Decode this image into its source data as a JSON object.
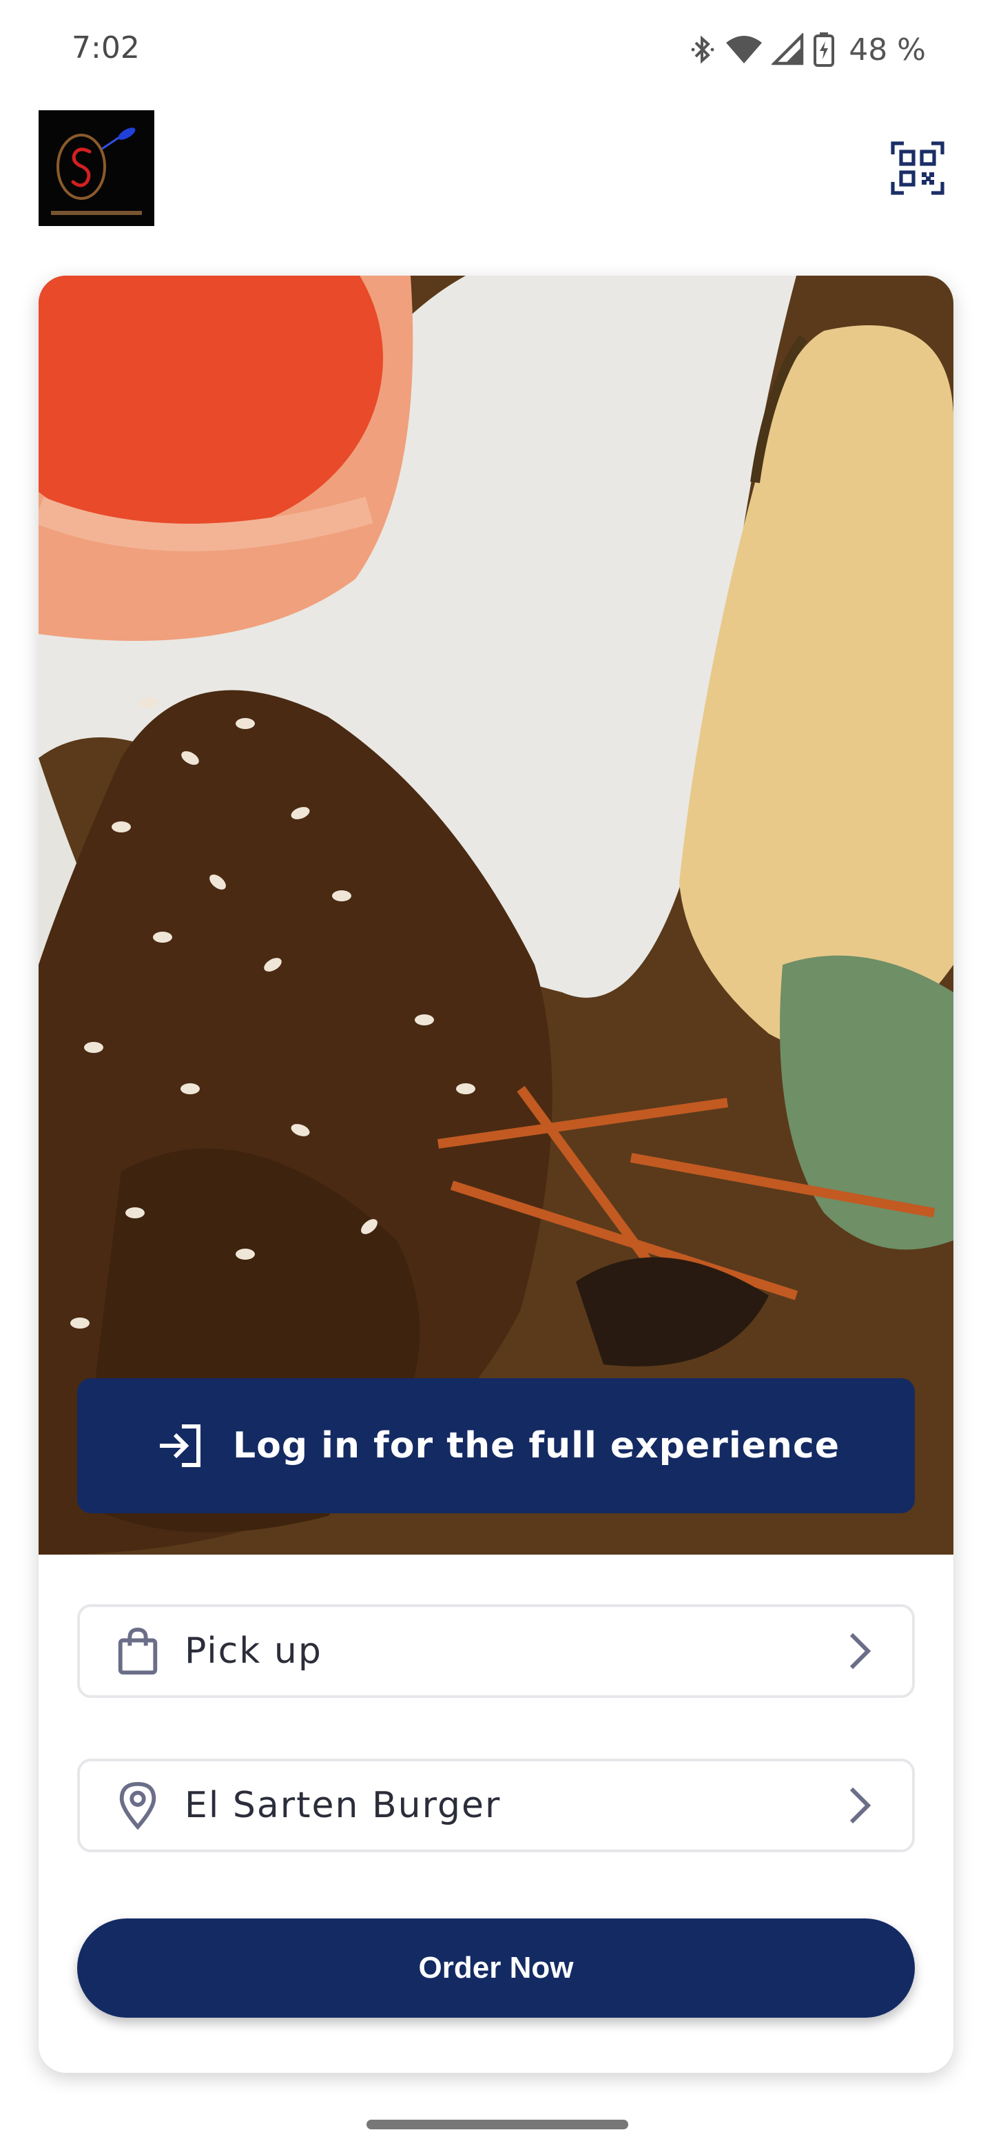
{
  "status_bar": {
    "time": "7:02",
    "battery_percent": "48 %",
    "icons": [
      "bluetooth-icon",
      "wifi-icon",
      "cell-signal-icon",
      "battery-charging-icon"
    ]
  },
  "header": {
    "logo_icon": "restaurant-logo-icon",
    "qr_icon": "qr-scanner-icon"
  },
  "hero": {
    "image": "food-photo"
  },
  "login_banner": {
    "icon": "login-arrow-icon",
    "label": "Log in for the full experience"
  },
  "order_options": [
    {
      "icon": "shopping-bag-icon",
      "label": "Pick up"
    },
    {
      "icon": "location-pin-icon",
      "label": "El Sarten Burger"
    }
  ],
  "order_button": {
    "label": "Order Now"
  },
  "colors": {
    "primary": "#142a63",
    "text": "#2b2d3a",
    "border": "#e6e7ea"
  }
}
